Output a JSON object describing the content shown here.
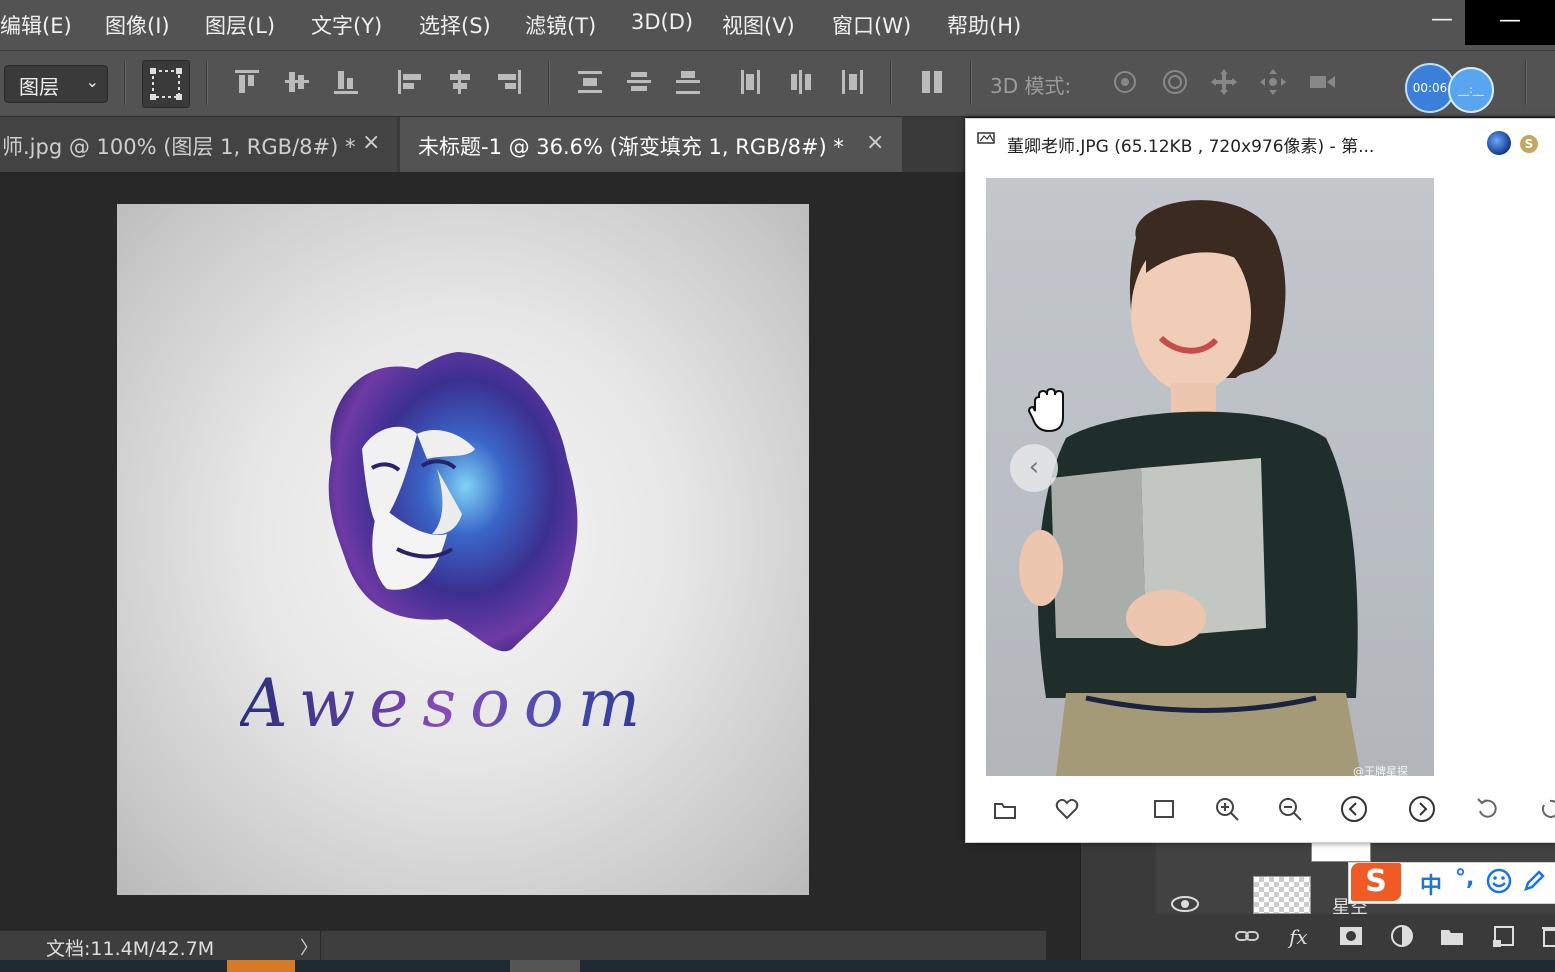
{
  "menu": [
    "编辑(E)",
    "图像(I)",
    "图层(L)",
    "文字(Y)",
    "选择(S)",
    "滤镜(T)",
    "3D(D)",
    "视图(V)",
    "窗口(W)",
    "帮助(H)"
  ],
  "window_controls": {
    "minimize": "—",
    "close": "—"
  },
  "options": {
    "layer_select_value": "图层",
    "mode_3d_label": "3D 模式:",
    "timer_a": "00:06",
    "timer_b": "__:__"
  },
  "tabs": [
    {
      "label": "师.jpg @ 100% (图层 1, RGB/8#) *",
      "close": "×"
    },
    {
      "label": "未标题-1 @ 36.6% (渐变填充 1, RGB/8#) *",
      "close": "×"
    }
  ],
  "canvas": {
    "text": "Awesoom"
  },
  "status": {
    "doc": "文档:11.4M/42.7M",
    "arrow": "〉"
  },
  "viewer": {
    "title": "董卿老师.JPG (65.12KB , 720x976像素) - 第...",
    "coin": "S",
    "watermark": "@王牌星探",
    "prev": "‹"
  },
  "layers": {
    "name": "星空"
  },
  "ime": {
    "logo": "S",
    "lang": "中",
    "punct": "°,"
  },
  "colors": {
    "menubar": "#535353",
    "workspace": "#282828",
    "accent": "#3a7fd9",
    "ime": "#f05a24"
  }
}
